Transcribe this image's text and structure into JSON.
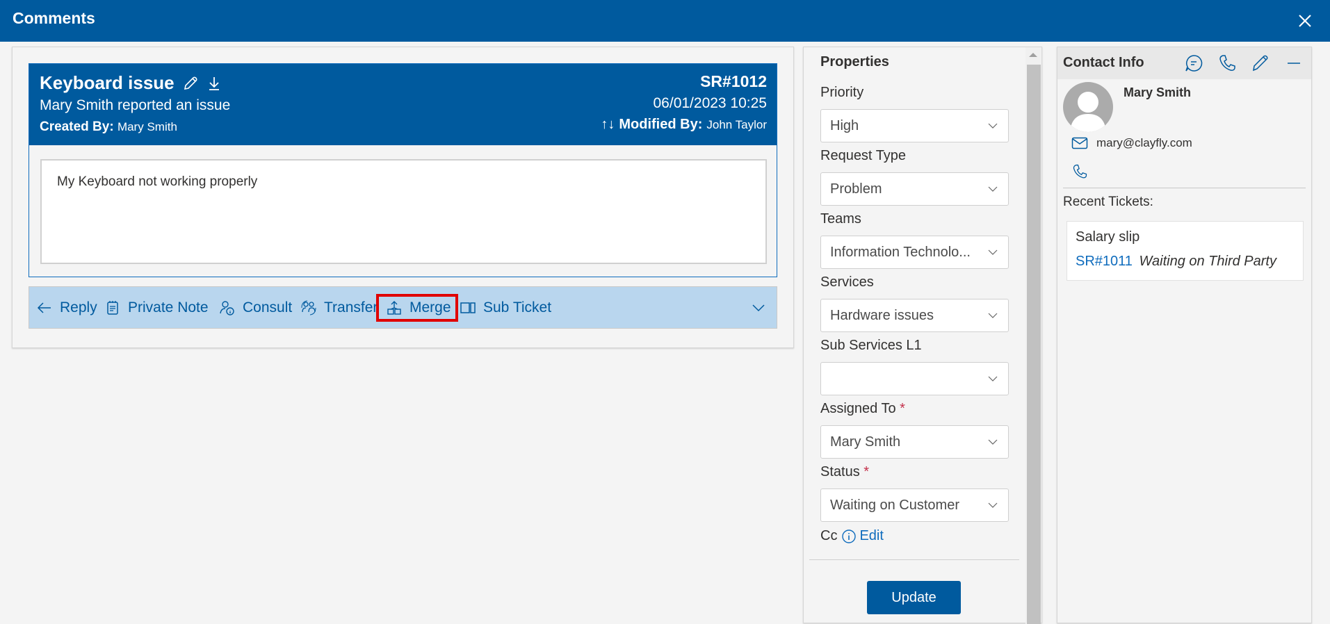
{
  "window": {
    "title": "Comments",
    "close_icon": "close-icon"
  },
  "ticket": {
    "title": "Keyboard issue",
    "subtitle": "Mary Smith reported an issue",
    "created_by_label": "Created By:",
    "created_by": "Mary Smith",
    "sr_number": "SR#1012",
    "datetime": "06/01/2023 10:25",
    "sort_icon": "↑↓",
    "modified_by_label": "Modified By:",
    "modified_by": "John Taylor",
    "description": "My Keyboard not working properly"
  },
  "actions": [
    {
      "label": "Reply",
      "icon": "reply-arrow-icon"
    },
    {
      "label": "Private Note",
      "icon": "note-icon"
    },
    {
      "label": "Consult",
      "icon": "consult-icon"
    },
    {
      "label": "Transfer",
      "icon": "transfer-icon"
    },
    {
      "label": "Merge",
      "icon": "merge-icon",
      "highlighted": true
    },
    {
      "label": "Sub Ticket",
      "icon": "sub-ticket-icon"
    }
  ],
  "properties": {
    "title": "Properties",
    "fields": [
      {
        "label": "Priority",
        "value": "High",
        "required": false
      },
      {
        "label": "Request Type",
        "value": "Problem",
        "required": false
      },
      {
        "label": "Teams",
        "value": "Information Technolo...",
        "required": false
      },
      {
        "label": "Services",
        "value": "Hardware issues",
        "required": false
      },
      {
        "label": "Sub Services L1",
        "value": "",
        "required": false
      },
      {
        "label": "Assigned To",
        "value": "Mary Smith",
        "required": true
      },
      {
        "label": "Status",
        "value": "Waiting on Customer",
        "required": true
      }
    ],
    "required_mark": "*",
    "cc_label": "Cc",
    "cc_edit": "Edit",
    "update_label": "Update"
  },
  "contact": {
    "title": "Contact Info",
    "name": "Mary Smith",
    "email": "mary@clayfly.com",
    "recent_label": "Recent Tickets:",
    "recent_tickets": [
      {
        "title": "Salary slip",
        "sr": "SR#1011",
        "status": "Waiting on Third Party"
      }
    ]
  },
  "colors": {
    "brand": "#005a9e",
    "action_bar": "#b9d6ee",
    "highlight": "#e00000",
    "link": "#0f6cbd",
    "required": "#c4314b"
  }
}
